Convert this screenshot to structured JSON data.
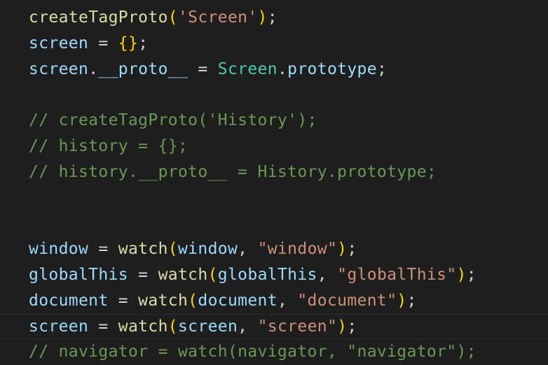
{
  "editor": {
    "lines": [
      {
        "tokens": [
          {
            "t": "createTagProto",
            "k": "function"
          },
          {
            "t": "(",
            "k": "bracket1"
          },
          {
            "t": "'Screen'",
            "k": "string"
          },
          {
            "t": ")",
            "k": "bracket1"
          },
          {
            "t": ";",
            "k": "punct"
          }
        ]
      },
      {
        "tokens": [
          {
            "t": "screen",
            "k": "variable"
          },
          {
            "t": " = ",
            "k": "operator"
          },
          {
            "t": "{}",
            "k": "bracket1"
          },
          {
            "t": ";",
            "k": "punct"
          }
        ]
      },
      {
        "tokens": [
          {
            "t": "screen",
            "k": "variable"
          },
          {
            "t": ".",
            "k": "punct"
          },
          {
            "t": "__proto__",
            "k": "property"
          },
          {
            "t": " = ",
            "k": "operator"
          },
          {
            "t": "Screen",
            "k": "type"
          },
          {
            "t": ".",
            "k": "punct"
          },
          {
            "t": "prototype",
            "k": "property"
          },
          {
            "t": ";",
            "k": "punct"
          }
        ]
      },
      {
        "tokens": []
      },
      {
        "tokens": [
          {
            "t": "// createTagProto('History');",
            "k": "comment"
          }
        ]
      },
      {
        "tokens": [
          {
            "t": "// history = {};",
            "k": "comment"
          }
        ]
      },
      {
        "tokens": [
          {
            "t": "// history.__proto__ = History.prototype;",
            "k": "comment"
          }
        ]
      },
      {
        "tokens": []
      },
      {
        "tokens": []
      },
      {
        "tokens": [
          {
            "t": "window",
            "k": "variable"
          },
          {
            "t": " = ",
            "k": "operator"
          },
          {
            "t": "watch",
            "k": "function"
          },
          {
            "t": "(",
            "k": "bracket1"
          },
          {
            "t": "window",
            "k": "variable"
          },
          {
            "t": ", ",
            "k": "punct"
          },
          {
            "t": "\"window\"",
            "k": "string"
          },
          {
            "t": ")",
            "k": "bracket1"
          },
          {
            "t": ";",
            "k": "punct"
          }
        ]
      },
      {
        "tokens": [
          {
            "t": "globalThis",
            "k": "variable"
          },
          {
            "t": " = ",
            "k": "operator"
          },
          {
            "t": "watch",
            "k": "function"
          },
          {
            "t": "(",
            "k": "bracket1"
          },
          {
            "t": "globalThis",
            "k": "variable"
          },
          {
            "t": ", ",
            "k": "punct"
          },
          {
            "t": "\"globalThis\"",
            "k": "string"
          },
          {
            "t": ")",
            "k": "bracket1"
          },
          {
            "t": ";",
            "k": "punct"
          }
        ]
      },
      {
        "tokens": [
          {
            "t": "document",
            "k": "variable"
          },
          {
            "t": " = ",
            "k": "operator"
          },
          {
            "t": "watch",
            "k": "function"
          },
          {
            "t": "(",
            "k": "bracket1"
          },
          {
            "t": "document",
            "k": "variable"
          },
          {
            "t": ", ",
            "k": "punct"
          },
          {
            "t": "\"document\"",
            "k": "string"
          },
          {
            "t": ")",
            "k": "bracket1"
          },
          {
            "t": ";",
            "k": "punct"
          }
        ]
      },
      {
        "current": true,
        "tokens": [
          {
            "t": "screen",
            "k": "variable"
          },
          {
            "t": " = ",
            "k": "operator"
          },
          {
            "t": "watch",
            "k": "function"
          },
          {
            "t": "(",
            "k": "bracket1"
          },
          {
            "t": "screen",
            "k": "variable"
          },
          {
            "t": ", ",
            "k": "punct"
          },
          {
            "t": "\"screen\"",
            "k": "string"
          },
          {
            "t": ")",
            "k": "bracket1"
          },
          {
            "t": ";",
            "k": "punct"
          }
        ]
      },
      {
        "tokens": [
          {
            "t": "// navigator = watch(navigator, \"navigator\");",
            "k": "comment"
          }
        ]
      }
    ]
  },
  "colors": {
    "background": "#1e1e1e",
    "default_text": "#d4d4d4",
    "function": "#dcdcaa",
    "variable": "#9cdcfe",
    "string": "#ce9178",
    "type": "#4ec9b0",
    "bracket_level1": "#ffd700",
    "comment": "#6a9955",
    "current_line_border": "#2c2c2c"
  }
}
